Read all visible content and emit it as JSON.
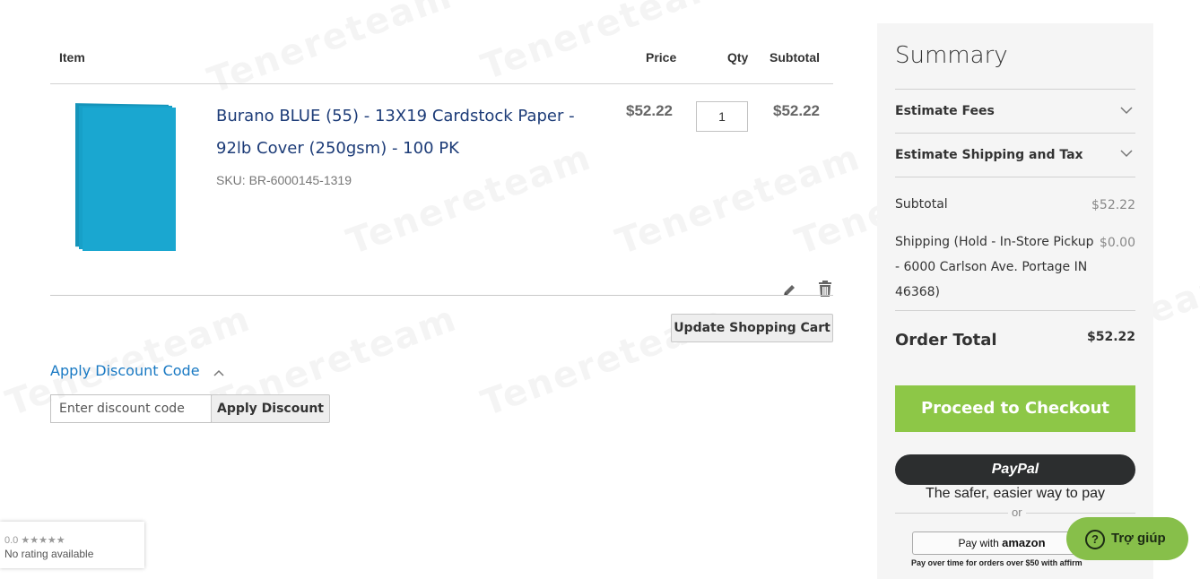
{
  "watermark": "Tenereteam",
  "cart": {
    "headers": {
      "item": "Item",
      "price": "Price",
      "qty": "Qty",
      "subtotal": "Subtotal"
    },
    "item": {
      "name": "Burano BLUE (55) - 13X19 Cardstock Paper - 92lb Cover (250gsm) - 100 PK",
      "sku": "SKU: BR-6000145-1319",
      "price": "$52.22",
      "qty": "1",
      "subtotal": "$52.22",
      "color": "#1aa7d0"
    },
    "update_button": "Update Shopping Cart"
  },
  "discount": {
    "title": "Apply Discount Code",
    "placeholder": "Enter discount code",
    "button": "Apply Discount"
  },
  "summary": {
    "title": "Summary",
    "estimate_fees": "Estimate Fees",
    "estimate_shipping": "Estimate Shipping and Tax",
    "subtotal_label": "Subtotal",
    "subtotal_value": "$52.22",
    "shipping_label_lines": [
      "Shipping (Hold - In-Store Pickup",
      "- 6000 Carlson Ave. Portage IN",
      "46368)"
    ],
    "shipping_value": "$0.00",
    "order_total_label": "Order Total",
    "order_total_value": "$52.22",
    "checkout_button": "Proceed to Checkout",
    "paypal_button": "PayPal",
    "paypal_tagline": "The safer, easier way to pay",
    "or": "or",
    "amazon_prefix": "Pay with",
    "amazon_brand": "amazon",
    "affirm_text": "Pay over time for orders over $50 with affirm"
  },
  "help": {
    "label": "Trợ giúp"
  },
  "rating": {
    "score": "0.0 ★★★★★",
    "text": "No rating available"
  },
  "colors": {
    "accent": "#1979c3",
    "checkout": "#8dc747",
    "help": "#87bf4a"
  }
}
